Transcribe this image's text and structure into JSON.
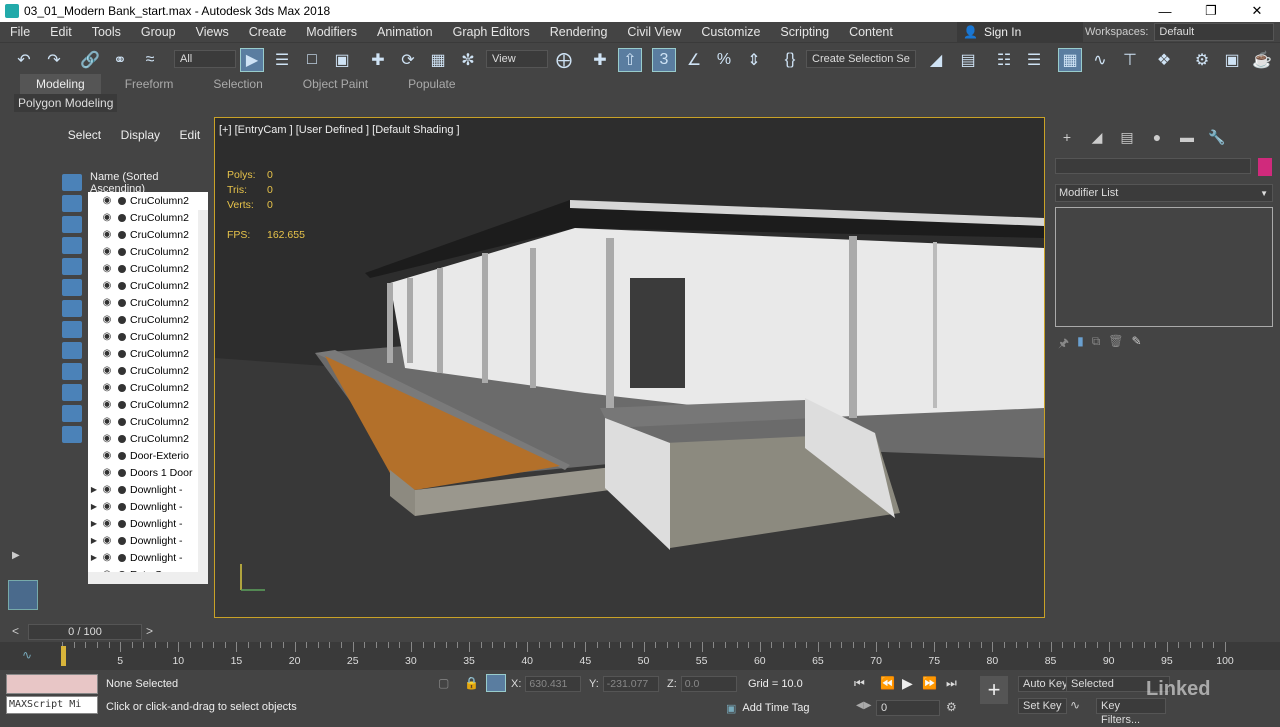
{
  "window": {
    "title": "03_01_Modern Bank_start.max - Autodesk 3ds Max 2018",
    "minimize": "—",
    "restore": "❐",
    "close": "✕"
  },
  "menu": [
    "File",
    "Edit",
    "Tools",
    "Group",
    "Views",
    "Create",
    "Modifiers",
    "Animation",
    "Graph Editors",
    "Rendering",
    "Civil View",
    "Customize",
    "Scripting",
    "Content"
  ],
  "signin": "Sign In",
  "workspaces": {
    "label": "Workspaces:",
    "value": "Default"
  },
  "toolbar": {
    "filter": "All",
    "refcoord": "View",
    "selection_set": "Create Selection Se"
  },
  "ribbon": {
    "tabs": [
      "Modeling",
      "Freeform",
      "Selection",
      "Object Paint",
      "Populate"
    ],
    "active": "Modeling",
    "panel": "Polygon Modeling"
  },
  "explorer": {
    "tabs": [
      "Select",
      "Display",
      "Edit"
    ],
    "column": "Name (Sorted Ascending)",
    "rows": [
      {
        "expand": "",
        "name": "CruColumn2"
      },
      {
        "expand": "",
        "name": "CruColumn2"
      },
      {
        "expand": "",
        "name": "CruColumn2"
      },
      {
        "expand": "",
        "name": "CruColumn2"
      },
      {
        "expand": "",
        "name": "CruColumn2"
      },
      {
        "expand": "",
        "name": "CruColumn2"
      },
      {
        "expand": "",
        "name": "CruColumn2"
      },
      {
        "expand": "",
        "name": "CruColumn2"
      },
      {
        "expand": "",
        "name": "CruColumn2"
      },
      {
        "expand": "",
        "name": "CruColumn2"
      },
      {
        "expand": "",
        "name": "CruColumn2"
      },
      {
        "expand": "",
        "name": "CruColumn2"
      },
      {
        "expand": "",
        "name": "CruColumn2"
      },
      {
        "expand": "",
        "name": "CruColumn2"
      },
      {
        "expand": "",
        "name": "CruColumn2"
      },
      {
        "expand": "",
        "name": "Door-Exterio"
      },
      {
        "expand": "",
        "name": "Doors 1 Door"
      },
      {
        "expand": "▶",
        "name": "Downlight -"
      },
      {
        "expand": "▶",
        "name": "Downlight -"
      },
      {
        "expand": "▶",
        "name": "Downlight -"
      },
      {
        "expand": "▶",
        "name": "Downlight -"
      },
      {
        "expand": "▶",
        "name": "Downlight -"
      },
      {
        "expand": "",
        "name": "EntryCam"
      }
    ]
  },
  "viewport": {
    "label": "[+] [EntryCam ] [User Defined ] [Default Shading ]",
    "polys_label": "Polys:",
    "polys": "0",
    "tris_label": "Tris:",
    "tris": "0",
    "verts_label": "Verts:",
    "verts": "0",
    "fps_label": "FPS:",
    "fps": "162.655"
  },
  "command_panel": {
    "modifier_list": "Modifier List",
    "object_color": "#d02a7c"
  },
  "timeline": {
    "frame": "0 / 100",
    "ticks": [
      "5",
      "10",
      "15",
      "20",
      "25",
      "30",
      "35",
      "40",
      "45",
      "50",
      "55",
      "60",
      "65",
      "70",
      "75",
      "80",
      "85",
      "90",
      "95",
      "100"
    ]
  },
  "status": {
    "maxscript": "MAXScript Mi",
    "selection": "None Selected",
    "prompt": "Click or click-and-drag to select objects",
    "x_label": "X:",
    "x": "630.431",
    "y_label": "Y:",
    "y": "-231.077",
    "z_label": "Z:",
    "z": "0.0",
    "grid": "Grid = 10.0",
    "add_time_tag": "Add Time Tag",
    "auto_key": "Auto Key",
    "set_key": "Set Key",
    "selected": "Selected",
    "key_filters": "Key Filters...",
    "current_frame": "0"
  },
  "watermark": "Linked"
}
